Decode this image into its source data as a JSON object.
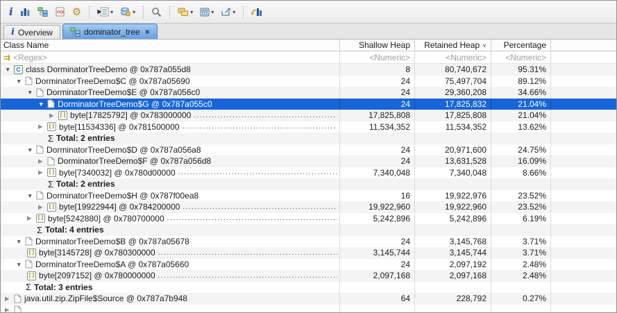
{
  "toolbar": {
    "items": [
      {
        "type": "button",
        "icon": "info-icon"
      },
      {
        "type": "button",
        "icon": "histogram-icon"
      },
      {
        "type": "button",
        "icon": "dominator-tree-icon"
      },
      {
        "type": "button",
        "icon": "oql-icon"
      },
      {
        "type": "button",
        "icon": "gear-icon"
      },
      {
        "type": "separator"
      },
      {
        "type": "button",
        "icon": "query-browser-icon",
        "dropdown": true
      },
      {
        "type": "button",
        "icon": "heap-dump-icon",
        "dropdown": true
      },
      {
        "type": "separator"
      },
      {
        "type": "button",
        "icon": "search-icon"
      },
      {
        "type": "separator"
      },
      {
        "type": "button",
        "icon": "group-by-icon",
        "dropdown": true
      },
      {
        "type": "button",
        "icon": "calculator-icon",
        "dropdown": true
      },
      {
        "type": "button",
        "icon": "export-icon",
        "dropdown": true
      },
      {
        "type": "separator"
      },
      {
        "type": "button",
        "icon": "compare-histogram-icon"
      }
    ]
  },
  "tabs": [
    {
      "label": "Overview",
      "icon": "info-icon",
      "active": false,
      "closable": false
    },
    {
      "label": "dominator_tree",
      "icon": "dominator-tree-icon",
      "active": true,
      "closable": true,
      "close_glyph": "×"
    }
  ],
  "table": {
    "columns": [
      {
        "label": "Class Name",
        "filter": "<Regex>",
        "align": "left"
      },
      {
        "label": "Shallow Heap",
        "filter": "<Numeric>",
        "align": "right"
      },
      {
        "label": "Retained Heap",
        "filter": "<Numeric>",
        "align": "right",
        "sort": "desc",
        "sort_glyph": "∨"
      },
      {
        "label": "Percentage",
        "filter": "<Numeric>",
        "align": "right"
      }
    ],
    "rows": [
      {
        "level": 0,
        "expander": "expanded",
        "icon": "class-icon",
        "label": "class DorminatorTreeDemo @ 0x787a055d8",
        "shallow": "8",
        "retained": "80,740,672",
        "percentage": "95.31%"
      },
      {
        "level": 1,
        "expander": "expanded",
        "icon": "object-icon",
        "label": "DorminatorTreeDemo$C @ 0x787a05690",
        "shallow": "24",
        "retained": "75,497,704",
        "percentage": "89.12%"
      },
      {
        "level": 2,
        "expander": "expanded",
        "icon": "object-icon",
        "label": "DorminatorTreeDemo$E @ 0x787a056c0",
        "shallow": "24",
        "retained": "29,360,208",
        "percentage": "34.66%"
      },
      {
        "level": 3,
        "expander": "expanded",
        "icon": "object-icon",
        "label": "DorminatorTreeDemo$G @ 0x787a055c0",
        "shallow": "24",
        "retained": "17,825,832",
        "percentage": "21.04%",
        "selected": true
      },
      {
        "level": 4,
        "expander": "collapsed",
        "icon": "array-icon",
        "label": "byte[17825792] @ 0x783000000",
        "leader": true,
        "shallow": "17,825,808",
        "retained": "17,825,808",
        "percentage": "21.04%"
      },
      {
        "level": 3,
        "expander": "collapsed",
        "icon": "array-icon",
        "label": "byte[11534336] @ 0x781500000",
        "leader": true,
        "shallow": "11,534,352",
        "retained": "11,534,352",
        "percentage": "13.62%"
      },
      {
        "level": 3,
        "expander": "none",
        "icon": "sigma-icon",
        "label": "Total: 2 entries",
        "bold": true,
        "shallow": "",
        "retained": "",
        "percentage": ""
      },
      {
        "level": 2,
        "expander": "expanded",
        "icon": "object-icon",
        "label": "DorminatorTreeDemo$D @ 0x787a056a8",
        "shallow": "24",
        "retained": "20,971,600",
        "percentage": "24.75%"
      },
      {
        "level": 3,
        "expander": "collapsed",
        "icon": "object-icon",
        "label": "DorminatorTreeDemo$F @ 0x787a056d8",
        "shallow": "24",
        "retained": "13,631,528",
        "percentage": "16.09%"
      },
      {
        "level": 3,
        "expander": "collapsed",
        "icon": "array-icon",
        "label": "byte[7340032] @ 0x780d00000",
        "leader": true,
        "shallow": "7,340,048",
        "retained": "7,340,048",
        "percentage": "8.66%"
      },
      {
        "level": 3,
        "expander": "none",
        "icon": "sigma-icon",
        "label": "Total: 2 entries",
        "bold": true,
        "shallow": "",
        "retained": "",
        "percentage": ""
      },
      {
        "level": 2,
        "expander": "expanded",
        "icon": "object-icon",
        "label": "DorminatorTreeDemo$H @ 0x787f00ea8",
        "shallow": "16",
        "retained": "19,922,976",
        "percentage": "23.52%"
      },
      {
        "level": 3,
        "expander": "collapsed",
        "icon": "array-icon",
        "label": "byte[19922944] @ 0x784200000",
        "leader": true,
        "shallow": "19,922,960",
        "retained": "19,922,960",
        "percentage": "23.52%"
      },
      {
        "level": 2,
        "expander": "collapsed",
        "icon": "array-icon",
        "label": "byte[5242880] @ 0x780700000",
        "leader": true,
        "shallow": "5,242,896",
        "retained": "5,242,896",
        "percentage": "6.19%"
      },
      {
        "level": 2,
        "expander": "none",
        "icon": "sigma-icon",
        "label": "Total: 4 entries",
        "bold": true,
        "shallow": "",
        "retained": "",
        "percentage": ""
      },
      {
        "level": 1,
        "expander": "expanded",
        "icon": "object-icon",
        "label": "DorminatorTreeDemo$B @ 0x787a05678",
        "shallow": "24",
        "retained": "3,145,768",
        "percentage": "3.71%"
      },
      {
        "level": 2,
        "expander": "none",
        "icon": "array-icon",
        "label": "byte[3145728] @ 0x780300000",
        "leader": true,
        "shallow": "3,145,744",
        "retained": "3,145,744",
        "percentage": "3.71%"
      },
      {
        "level": 1,
        "expander": "expanded",
        "icon": "object-icon",
        "label": "DorminatorTreeDemo$A @ 0x787a05660",
        "shallow": "24",
        "retained": "2,097,192",
        "percentage": "2.48%"
      },
      {
        "level": 2,
        "expander": "none",
        "icon": "array-icon",
        "label": "byte[2097152] @ 0x780000000",
        "leader": true,
        "shallow": "2,097,168",
        "retained": "2,097,168",
        "percentage": "2.48%"
      },
      {
        "level": 1,
        "expander": "none",
        "icon": "sigma-icon",
        "label": "Total: 3 entries",
        "bold": true,
        "shallow": "",
        "retained": "",
        "percentage": ""
      },
      {
        "level": 0,
        "expander": "collapsed",
        "icon": "object-icon",
        "label": "java.util.zip.ZipFile$Source @ 0x787a7b948",
        "shallow": "64",
        "retained": "228,792",
        "percentage": "0.27%"
      },
      {
        "level": 0,
        "expander": "collapsed",
        "icon": "object-icon",
        "label": "",
        "partial": true,
        "shallow": "",
        "retained": "",
        "percentage": ""
      }
    ]
  },
  "colors": {
    "selection_bg": "#1765d8",
    "selection_text": "#ffffff",
    "stripe": "#f4f4f4",
    "tab_active_top": "#a6cbf2",
    "tab_active_bottom": "#66a0e0",
    "grid_line": "#dadada"
  }
}
